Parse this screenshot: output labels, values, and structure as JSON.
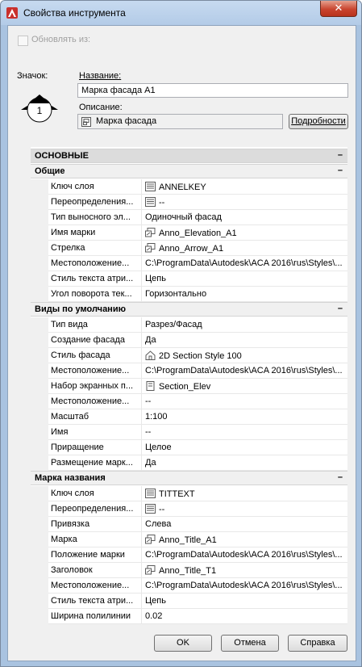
{
  "window": {
    "title": "Свойства инструмента",
    "close_glyph": "✕"
  },
  "update_from": {
    "label": "Обновлять из:",
    "checked": false
  },
  "icon_label": "Значок:",
  "symbol_number": "1",
  "name": {
    "label": "Название:",
    "value": "Марка фасада A1"
  },
  "description": {
    "label": "Описание:",
    "value": "Марка фасада",
    "details_button": "Подробности"
  },
  "grid": {
    "top_category": "ОСНОВНЫЕ",
    "collapse_glyph": "–",
    "general": {
      "title": "Общие",
      "rows": [
        {
          "name": "Ключ слоя",
          "value": "ANNELKEY",
          "icon": "layer-key-icon"
        },
        {
          "name": "Переопределения...",
          "value": "--",
          "icon": "layer-key-icon"
        },
        {
          "name": "Тип выносного эл...",
          "value": "Одиночный фасад",
          "icon": ""
        },
        {
          "name": "Имя марки",
          "value": "Anno_Elevation_A1",
          "icon": "block-icon"
        },
        {
          "name": "Стрелка",
          "value": "Anno_Arrow_A1",
          "icon": "block-icon"
        },
        {
          "name": "Местоположение...",
          "value": "C:\\ProgramData\\Autodesk\\ACA 2016\\rus\\Styles\\...",
          "icon": ""
        },
        {
          "name": "Стиль текста атри...",
          "value": "Цепь",
          "icon": ""
        },
        {
          "name": "Угол поворота тек...",
          "value": "Горизонтально",
          "icon": ""
        }
      ]
    },
    "default_views": {
      "title": "Виды по умолчанию",
      "rows": [
        {
          "name": "Тип вида",
          "value": "Разрез/Фасад",
          "icon": ""
        },
        {
          "name": "Создание фасада",
          "value": "Да",
          "icon": ""
        },
        {
          "name": "Стиль фасада",
          "value": "2D Section Style 100",
          "icon": "house-icon"
        },
        {
          "name": "Местоположение...",
          "value": "C:\\ProgramData\\Autodesk\\ACA 2016\\rus\\Styles\\...",
          "icon": ""
        },
        {
          "name": "Набор экранных п...",
          "value": "Section_Elev",
          "icon": "display-set-icon"
        },
        {
          "name": "Местоположение...",
          "value": "--",
          "icon": ""
        },
        {
          "name": "Масштаб",
          "value": "1:100",
          "icon": ""
        },
        {
          "name": "Имя",
          "value": "--",
          "icon": ""
        },
        {
          "name": "Приращение",
          "value": "Целое",
          "icon": ""
        },
        {
          "name": "Размещение марк...",
          "value": "Да",
          "icon": ""
        }
      ]
    },
    "title_mark": {
      "title": "Марка названия",
      "rows": [
        {
          "name": "Ключ слоя",
          "value": "TITTEXT",
          "icon": "layer-key-icon"
        },
        {
          "name": "Переопределения...",
          "value": "--",
          "icon": "layer-key-icon"
        },
        {
          "name": "Привязка",
          "value": "Слева",
          "icon": ""
        },
        {
          "name": "Марка",
          "value": "Anno_Title_A1",
          "icon": "block-icon"
        },
        {
          "name": "Положение марки",
          "value": "C:\\ProgramData\\Autodesk\\ACA 2016\\rus\\Styles\\...",
          "icon": ""
        },
        {
          "name": "Заголовок",
          "value": "Anno_Title_T1",
          "icon": "block-icon"
        },
        {
          "name": "Местоположение...",
          "value": "C:\\ProgramData\\Autodesk\\ACA 2016\\rus\\Styles\\...",
          "icon": ""
        },
        {
          "name": "Стиль текста атри...",
          "value": "Цепь",
          "icon": ""
        },
        {
          "name": "Ширина полилинии",
          "value": "0.02",
          "icon": ""
        }
      ]
    }
  },
  "buttons": {
    "ok": "OK",
    "cancel": "Отмена",
    "help": "Справка"
  },
  "colors": {
    "accent": "#c9452f",
    "titlebar": "#b3cbe7",
    "panel": "#f0f0f0"
  }
}
